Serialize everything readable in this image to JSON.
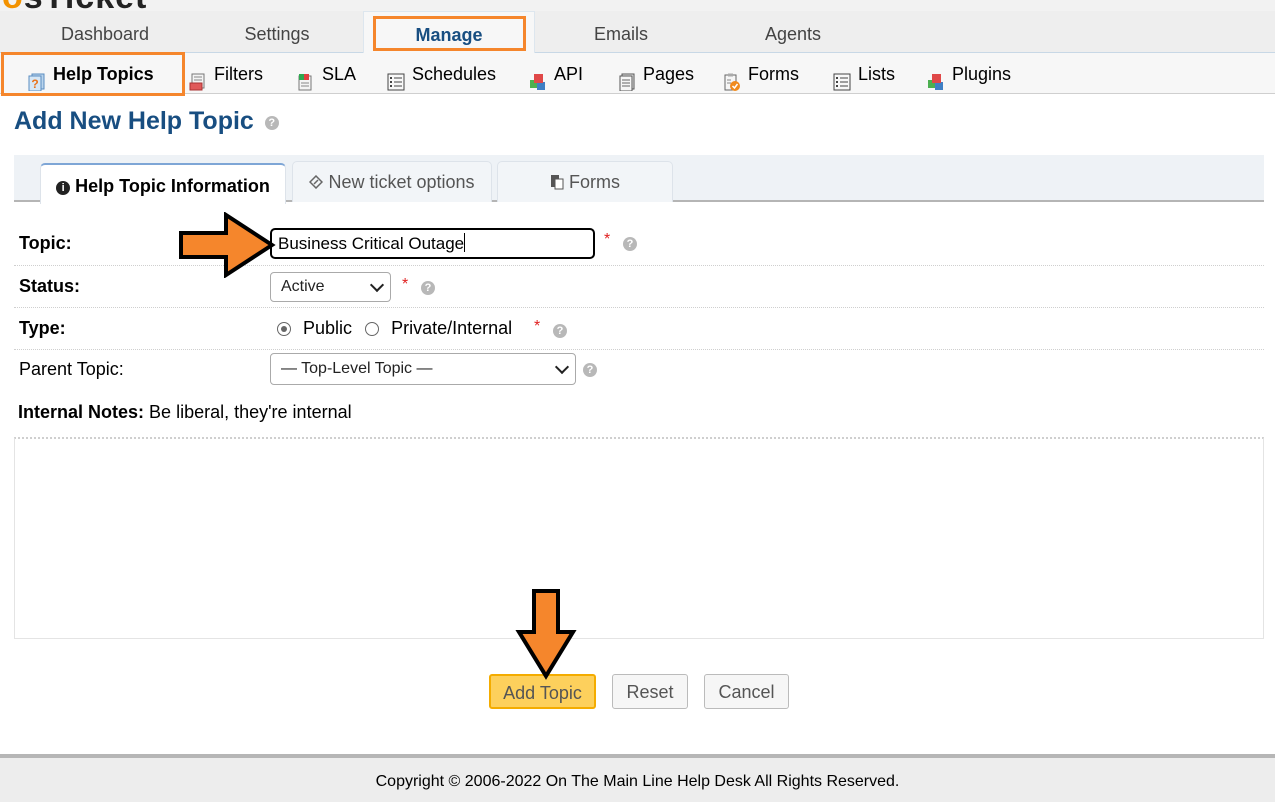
{
  "logo": {
    "text_prefix": "o",
    "text": "sTicket"
  },
  "main_nav": {
    "items": [
      {
        "label": "Dashboard",
        "active": false
      },
      {
        "label": "Settings",
        "active": false
      },
      {
        "label": "Manage",
        "active": true
      },
      {
        "label": "Emails",
        "active": false
      },
      {
        "label": "Agents",
        "active": false
      }
    ]
  },
  "sub_nav": {
    "items": [
      {
        "label": "Help Topics",
        "icon": "help-topics-icon",
        "active": true
      },
      {
        "label": "Filters",
        "icon": "filters-icon",
        "active": false
      },
      {
        "label": "SLA",
        "icon": "sla-icon",
        "active": false
      },
      {
        "label": "Schedules",
        "icon": "schedules-icon",
        "active": false
      },
      {
        "label": "API",
        "icon": "api-icon",
        "active": false
      },
      {
        "label": "Pages",
        "icon": "pages-icon",
        "active": false
      },
      {
        "label": "Forms",
        "icon": "forms-icon",
        "active": false
      },
      {
        "label": "Lists",
        "icon": "lists-icon",
        "active": false
      },
      {
        "label": "Plugins",
        "icon": "plugins-icon",
        "active": false
      }
    ]
  },
  "page": {
    "title": "Add New Help Topic",
    "help_glyph": "?"
  },
  "tabs": [
    {
      "label": "Help Topic Information",
      "icon": "info-icon",
      "active": true
    },
    {
      "label": "New ticket options",
      "icon": "ticket-icon",
      "active": false
    },
    {
      "label": "Forms",
      "icon": "forms-icon",
      "active": false
    }
  ],
  "form": {
    "topic": {
      "label": "Topic:",
      "value": "Business Critical Outage",
      "required_mark": "*"
    },
    "status": {
      "label": "Status:",
      "selected": "Active",
      "required_mark": "*"
    },
    "type": {
      "label": "Type:",
      "options": [
        {
          "label": "Public",
          "checked": true
        },
        {
          "label": "Private/Internal",
          "checked": false
        }
      ],
      "required_mark": "*"
    },
    "parent_topic": {
      "label": "Parent Topic:",
      "selected": "— Top-Level Topic —"
    },
    "internal_notes": {
      "label": "Internal Notes:",
      "hint": "Be liberal, they're internal",
      "value": ""
    }
  },
  "buttons": {
    "add": "Add Topic",
    "reset": "Reset",
    "cancel": "Cancel"
  },
  "footer": {
    "text": "Copyright © 2006-2022 On The Main Line Help Desk All Rights Reserved."
  },
  "colors": {
    "brand_blue": "#184E81",
    "highlight_orange": "#f5862c",
    "primary_button": "#fdd05c",
    "required_red": "#e02020"
  }
}
